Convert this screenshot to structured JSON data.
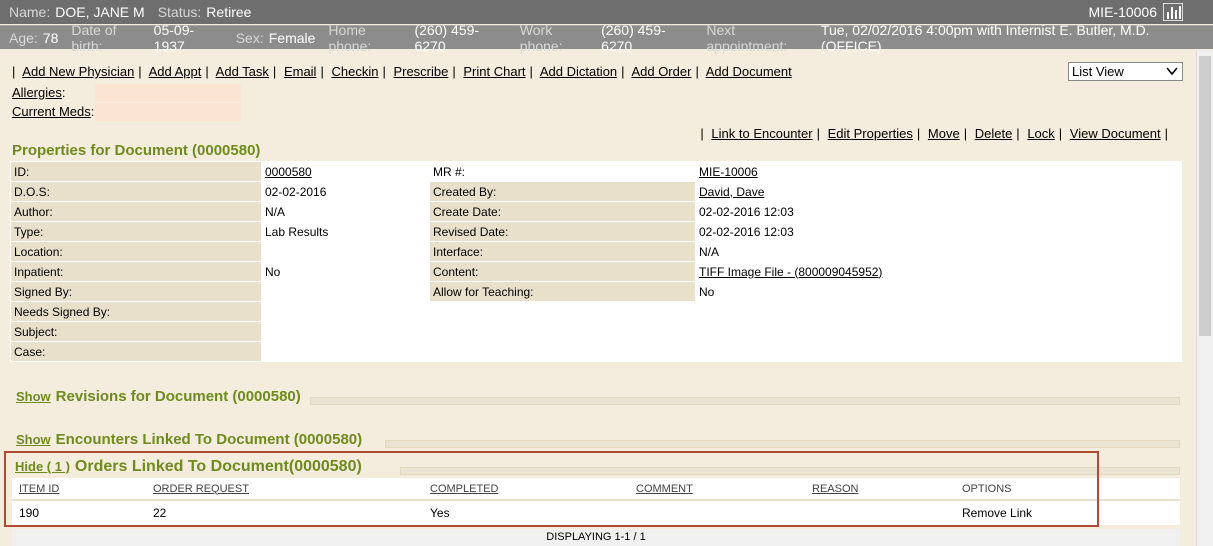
{
  "header": {
    "name_label": "Name:",
    "name": "DOE, JANE M",
    "status_label": "Status:",
    "status": "Retiree",
    "mrn": "MIE-10006",
    "chart_icon": "bar-chart-icon",
    "age_label": "Age:",
    "age": "78",
    "dob_label": "Date of birth:",
    "dob": "05-09-1937",
    "sex_label": "Sex:",
    "sex": "Female",
    "home_phone_label": "Home phone:",
    "home_phone": "(260) 459-6270",
    "work_phone_label": "Work phone:",
    "work_phone": "(260) 459-6270",
    "next_appt_label": "Next appointment:",
    "next_appt": "Tue, 02/02/2016 4:00pm with Internist E. Butler, M.D. (OFFICE)"
  },
  "actions": [
    "Add New Physician",
    "Add Appt",
    "Add Task",
    "Email",
    "Checkin",
    "Prescribe",
    "Print Chart",
    "Add Dictation",
    "Add Order",
    "Add Document"
  ],
  "view_select": {
    "value": "List View"
  },
  "allergies_label": "Allergies",
  "meds_label": "Current Meds",
  "doc_actions": [
    "Link to Encounter",
    "Edit Properties",
    "Move",
    "Delete",
    "Lock",
    "View Document"
  ],
  "properties": {
    "title": "Properties for Document (0000580)",
    "id_label": "ID:",
    "id": "0000580",
    "mr_label": "MR #:",
    "mr": "MIE-10006",
    "dos_label": "D.O.S:",
    "dos": "02-02-2016",
    "created_by_label": "Created By:",
    "created_by": "David, Dave",
    "author_label": "Author:",
    "author": "N/A",
    "create_date_label": "Create Date:",
    "create_date": "02-02-2016 12:03",
    "type_label": "Type:",
    "type": "Lab Results",
    "revised_date_label": "Revised Date:",
    "revised_date": "02-02-2016 12:03",
    "location_label": "Location:",
    "location": "",
    "interface_label": "Interface:",
    "interface": "N/A",
    "inpatient_label": "Inpatient:",
    "inpatient": "No",
    "content_label": "Content:",
    "content": "TIFF Image File - (800009045952)",
    "signed_by_label": "Signed By:",
    "signed_by": "",
    "allow_teaching_label": "Allow for Teaching:",
    "allow_teaching": "No",
    "needs_signed_label": "Needs Signed By:",
    "subject_label": "Subject:",
    "case_label": "Case:"
  },
  "revisions": {
    "toggle": "Show",
    "title": "Revisions for Document (0000580)"
  },
  "encounters": {
    "toggle": "Show",
    "title": "Encounters Linked To Document (0000580)"
  },
  "orders": {
    "toggle": "Hide ( 1 )",
    "title": "Orders Linked To Document(0000580)",
    "columns": [
      "ITEM ID",
      "ORDER REQUEST",
      "COMPLETED",
      "COMMENT",
      "REASON",
      "OPTIONS"
    ],
    "rows": [
      {
        "item_id": "190",
        "order_request": "22",
        "completed": "Yes",
        "comment": "",
        "reason": "",
        "option": "Remove Link"
      }
    ],
    "footer": "DISPLAYING 1-1 / 1"
  },
  "colors": {
    "accent_green": "#6e8b1d",
    "highlight": "#b24a32",
    "background": "#f4ecdc"
  }
}
